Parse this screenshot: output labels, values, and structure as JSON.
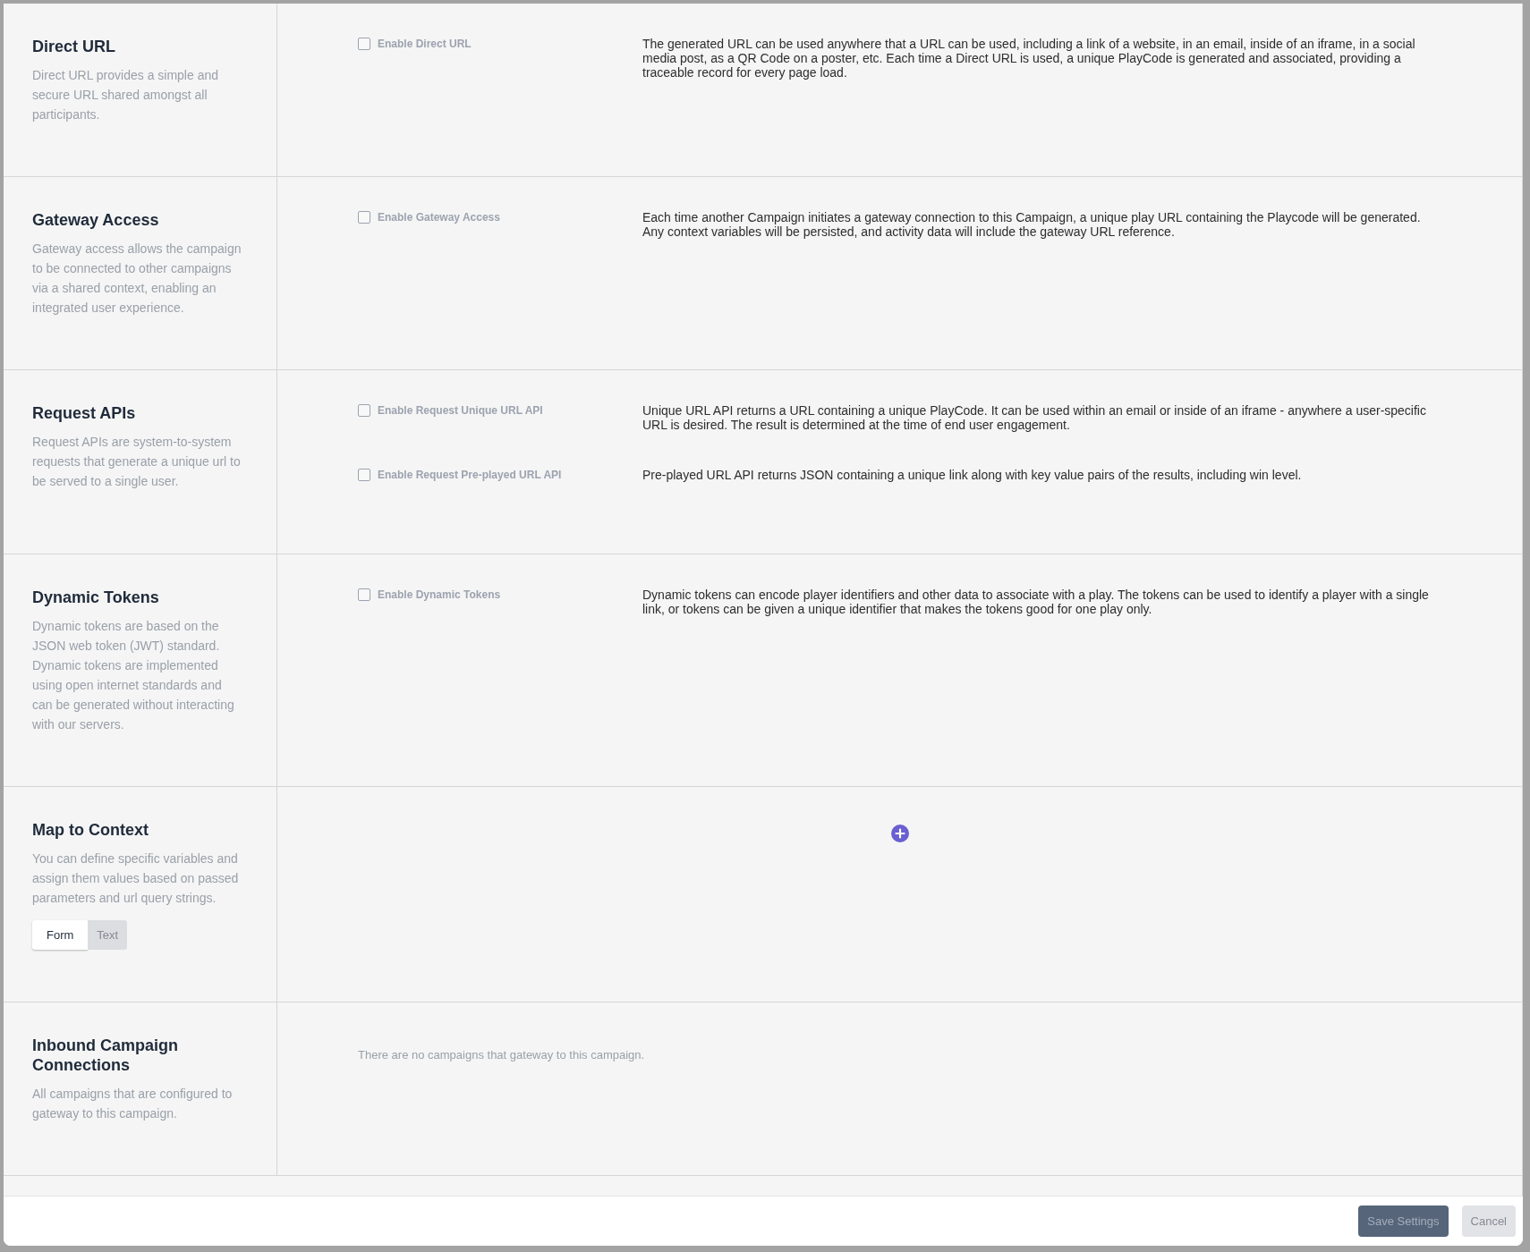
{
  "sections": [
    {
      "kind": "options",
      "title": "Direct URL",
      "description": "Direct URL provides a simple and secure URL shared amongst all participants.",
      "options": [
        {
          "label": "Enable Direct URL",
          "checked": false,
          "description": "The generated URL can be used anywhere that a URL can be used, including a link of a website, in an email, inside of an iframe, in a social media post, as a QR Code on a poster, etc. Each time a Direct URL is used, a unique PlayCode is generated and associated, providing a traceable record for every page load."
        }
      ]
    },
    {
      "kind": "options",
      "title": "Gateway Access",
      "description": "Gateway access allows the campaign to be connected to other campaigns via a shared context, enabling an integrated user experience.",
      "options": [
        {
          "label": "Enable Gateway Access",
          "checked": false,
          "description": "Each time another Campaign initiates a gateway connection to this Campaign, a unique play URL containing the Playcode will be generated. Any context variables will be persisted, and activity data will include the gateway URL reference."
        }
      ]
    },
    {
      "kind": "options",
      "title": "Request APIs",
      "description": "Request APIs are system-to-system requests that generate a unique url to be served to a single user.",
      "options": [
        {
          "label": "Enable Request Unique URL API",
          "checked": false,
          "description": "Unique URL API returns a URL containing a unique PlayCode. It can be used within an email or inside of an iframe - anywhere a user-specific URL is desired. The result is determined at the time of end user engagement."
        },
        {
          "label": "Enable Request Pre-played URL API",
          "checked": false,
          "description": "Pre-played URL API returns JSON containing a unique link along with key value pairs of the results, including win level."
        }
      ]
    },
    {
      "kind": "options",
      "title": "Dynamic Tokens",
      "description": "Dynamic tokens are based on the JSON web token (JWT) standard. Dynamic tokens are implemented using open internet standards and can be generated without interacting with our servers.",
      "options": [
        {
          "label": "Enable Dynamic Tokens",
          "checked": false,
          "description": "Dynamic tokens can encode player identifiers and other data to associate with a play. The tokens can be used to identify a player with a single link, or tokens can be given a unique identifier that makes the tokens good for one play only."
        }
      ]
    },
    {
      "kind": "mapping",
      "title": "Map to Context",
      "description": "You can define specific variables and assign them values based on passed parameters and url query strings.",
      "toggle": [
        {
          "label": "Form",
          "selected": true
        },
        {
          "label": "Text",
          "selected": false
        }
      ]
    },
    {
      "kind": "connections",
      "title": "Inbound Campaign Connections",
      "description": "All campaigns that are configured to gateway to this campaign.",
      "empty_message": "There are no campaigns that gateway to this campaign."
    }
  ],
  "footer": {
    "buttons": [
      {
        "label": "Save Settings",
        "kind": "primary"
      },
      {
        "label": "Cancel",
        "kind": "secondary"
      }
    ]
  }
}
